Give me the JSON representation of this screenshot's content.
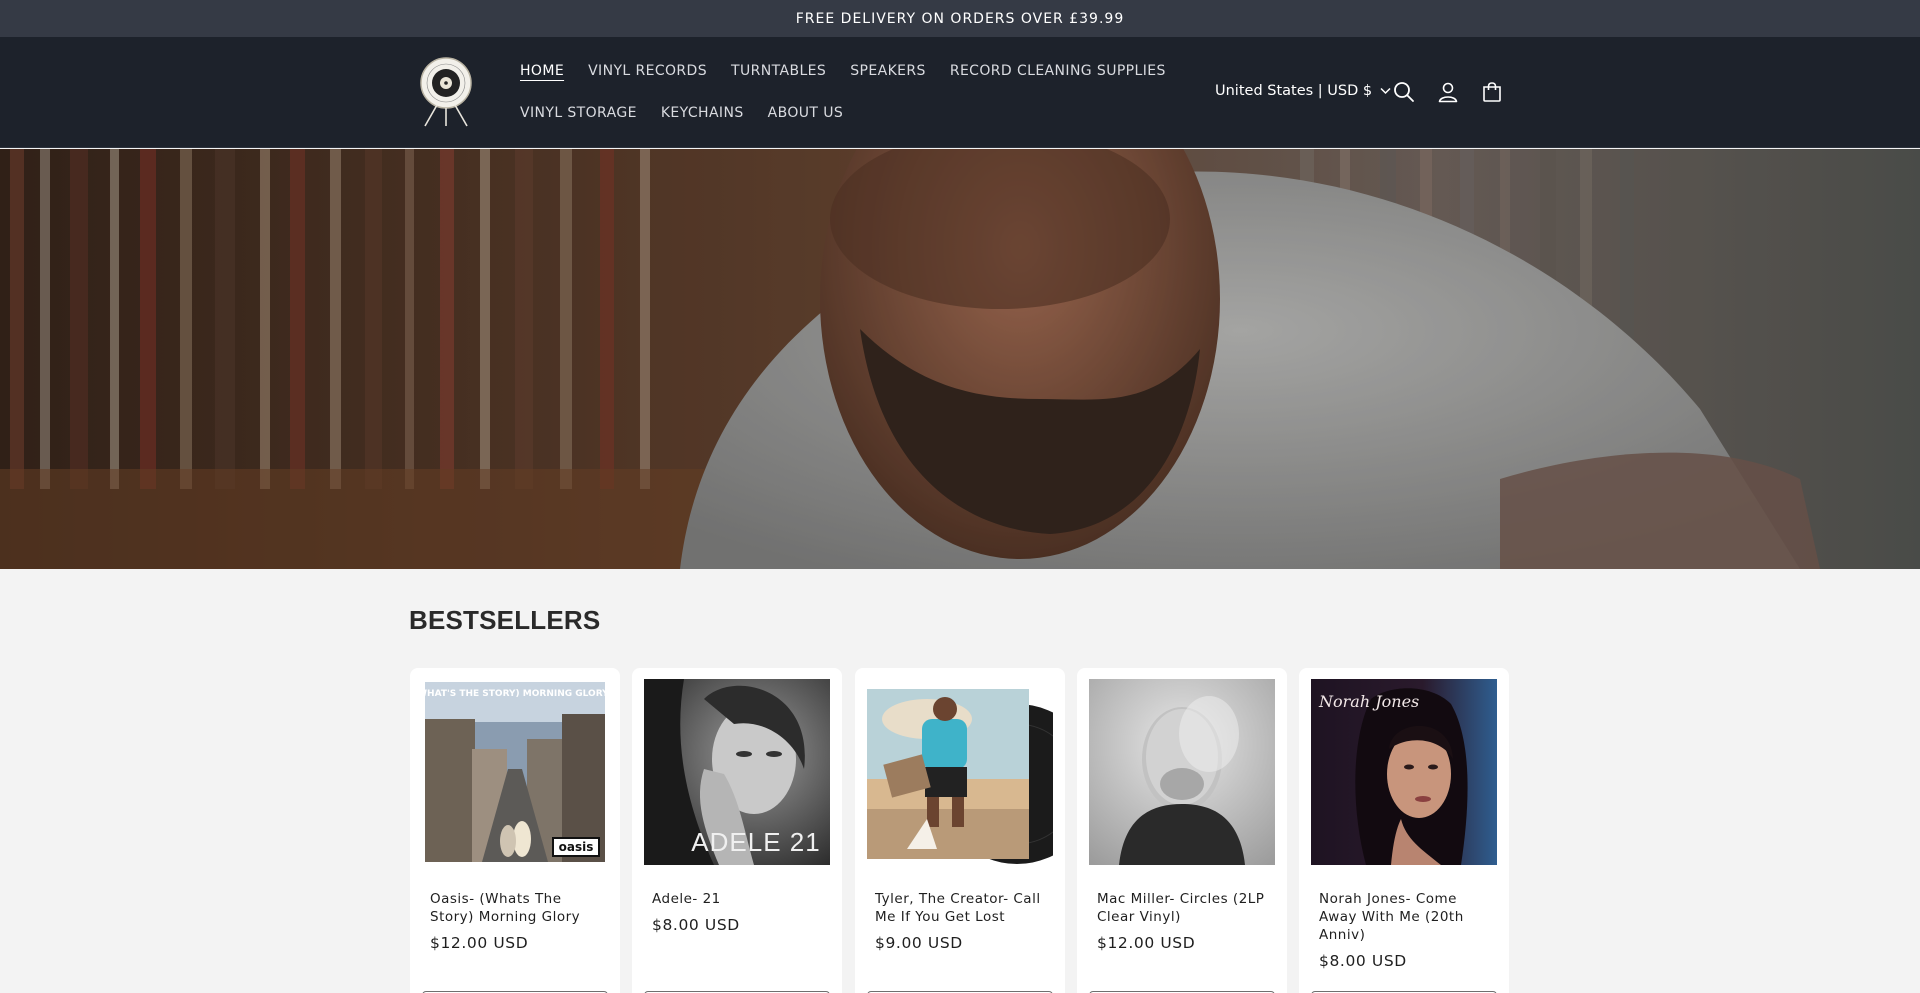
{
  "announcement": {
    "text": "FREE DELIVERY ON ORDERS OVER £39.99"
  },
  "header": {
    "nav_row1": [
      "HOME",
      "VINYL RECORDS",
      "TURNTABLES",
      "SPEAKERS",
      "RECORD CLEANING SUPPLIES"
    ],
    "nav_row2": [
      "VINYL STORAGE",
      "KEYCHAINS",
      "ABOUT US"
    ],
    "active_nav": "HOME",
    "country": "United States | USD $",
    "icons": [
      "search-icon",
      "account-icon",
      "cart-icon"
    ]
  },
  "section": {
    "title": "BESTSELLERS"
  },
  "products": [
    {
      "name": "Oasis- (Whats The Story) Morning Glory",
      "price": "$12.00 USD",
      "cover_text": "(WHAT'S THE STORY) MORNING GLORY ?",
      "cover_logo": "oasis"
    },
    {
      "name": "Adele- 21",
      "price": "$8.00 USD",
      "cover_text": "ADELE 21"
    },
    {
      "name": "Tyler, The Creator- Call Me If You Get Lost",
      "price": "$9.00 USD"
    },
    {
      "name": "Mac Miller- Circles (2LP Clear Vinyl)",
      "price": "$12.00 USD"
    },
    {
      "name": "Norah Jones- Come Away With Me (20th Anniv)",
      "price": "$8.00 USD",
      "cover_text": "Norah Jones"
    }
  ],
  "colors": {
    "announcement_bg": "#353a45",
    "header_bg": "#1d222b",
    "page_bg": "#f3f3f3"
  }
}
